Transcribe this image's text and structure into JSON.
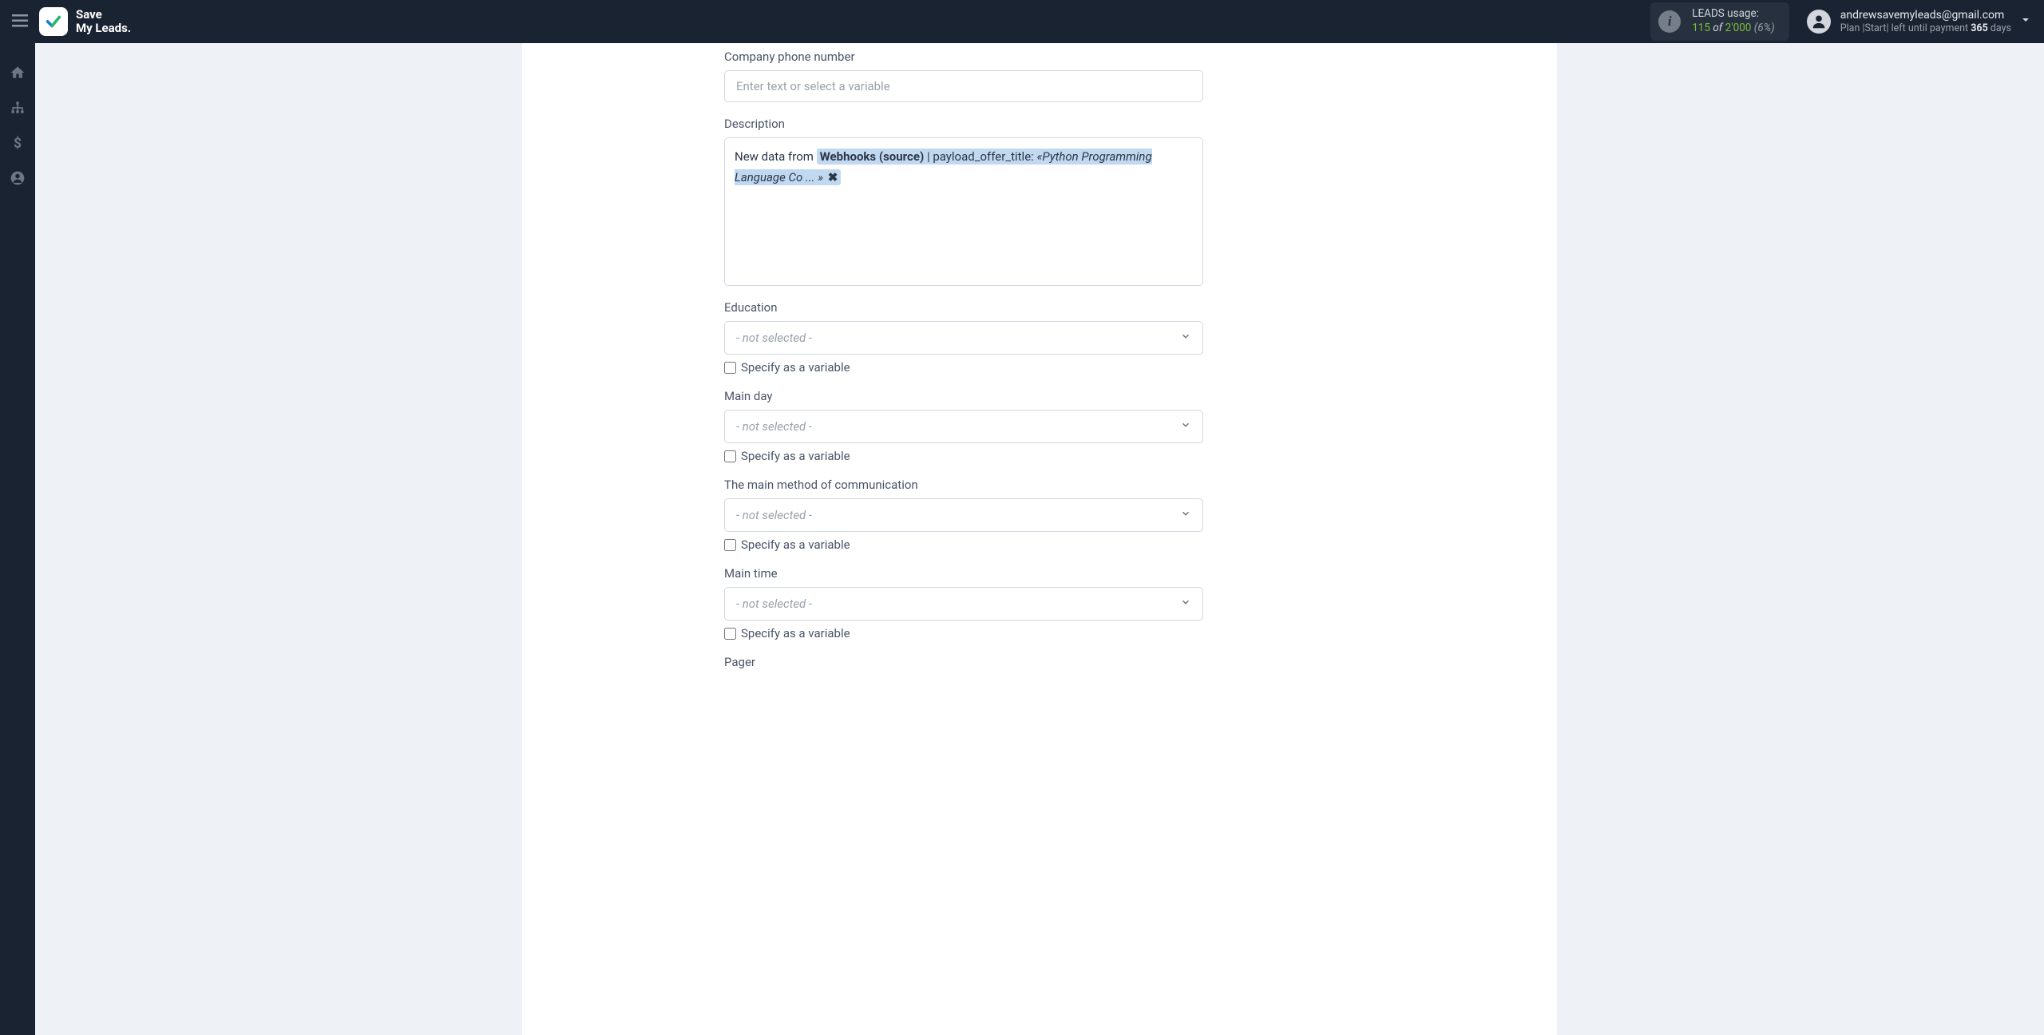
{
  "brand": {
    "line1": "Save",
    "line2": "My Leads."
  },
  "leads_usage": {
    "title": "LEADS usage:",
    "used": "115",
    "of_word": "of",
    "total": "2'000",
    "pct": "(6%)"
  },
  "user": {
    "email": "andrewsavemyleads@gmail.com",
    "plan_prefix": "Plan |",
    "plan_name": "Start",
    "plan_mid": "|  left until payment",
    "days_num": "365",
    "days_word": "days"
  },
  "form": {
    "company_phone": {
      "label": "Company phone number",
      "placeholder": "Enter text or select a variable"
    },
    "description": {
      "label": "Description",
      "prefix_text": "New data from ",
      "chip_source": "Webhooks (source)",
      "chip_sep": " | payload_offer_title: ",
      "chip_value": "«Python Programming Language Co ... »",
      "chip_remove": "✖"
    },
    "education": {
      "label": "Education",
      "value": "- not selected -",
      "checkbox_label": "Specify as a variable"
    },
    "main_day": {
      "label": "Main day",
      "value": "- not selected -",
      "checkbox_label": "Specify as a variable"
    },
    "main_method": {
      "label": "The main method of communication",
      "value": "- not selected -",
      "checkbox_label": "Specify as a variable"
    },
    "main_time": {
      "label": "Main time",
      "value": "- not selected -",
      "checkbox_label": "Specify as a variable"
    },
    "pager": {
      "label": "Pager"
    }
  }
}
